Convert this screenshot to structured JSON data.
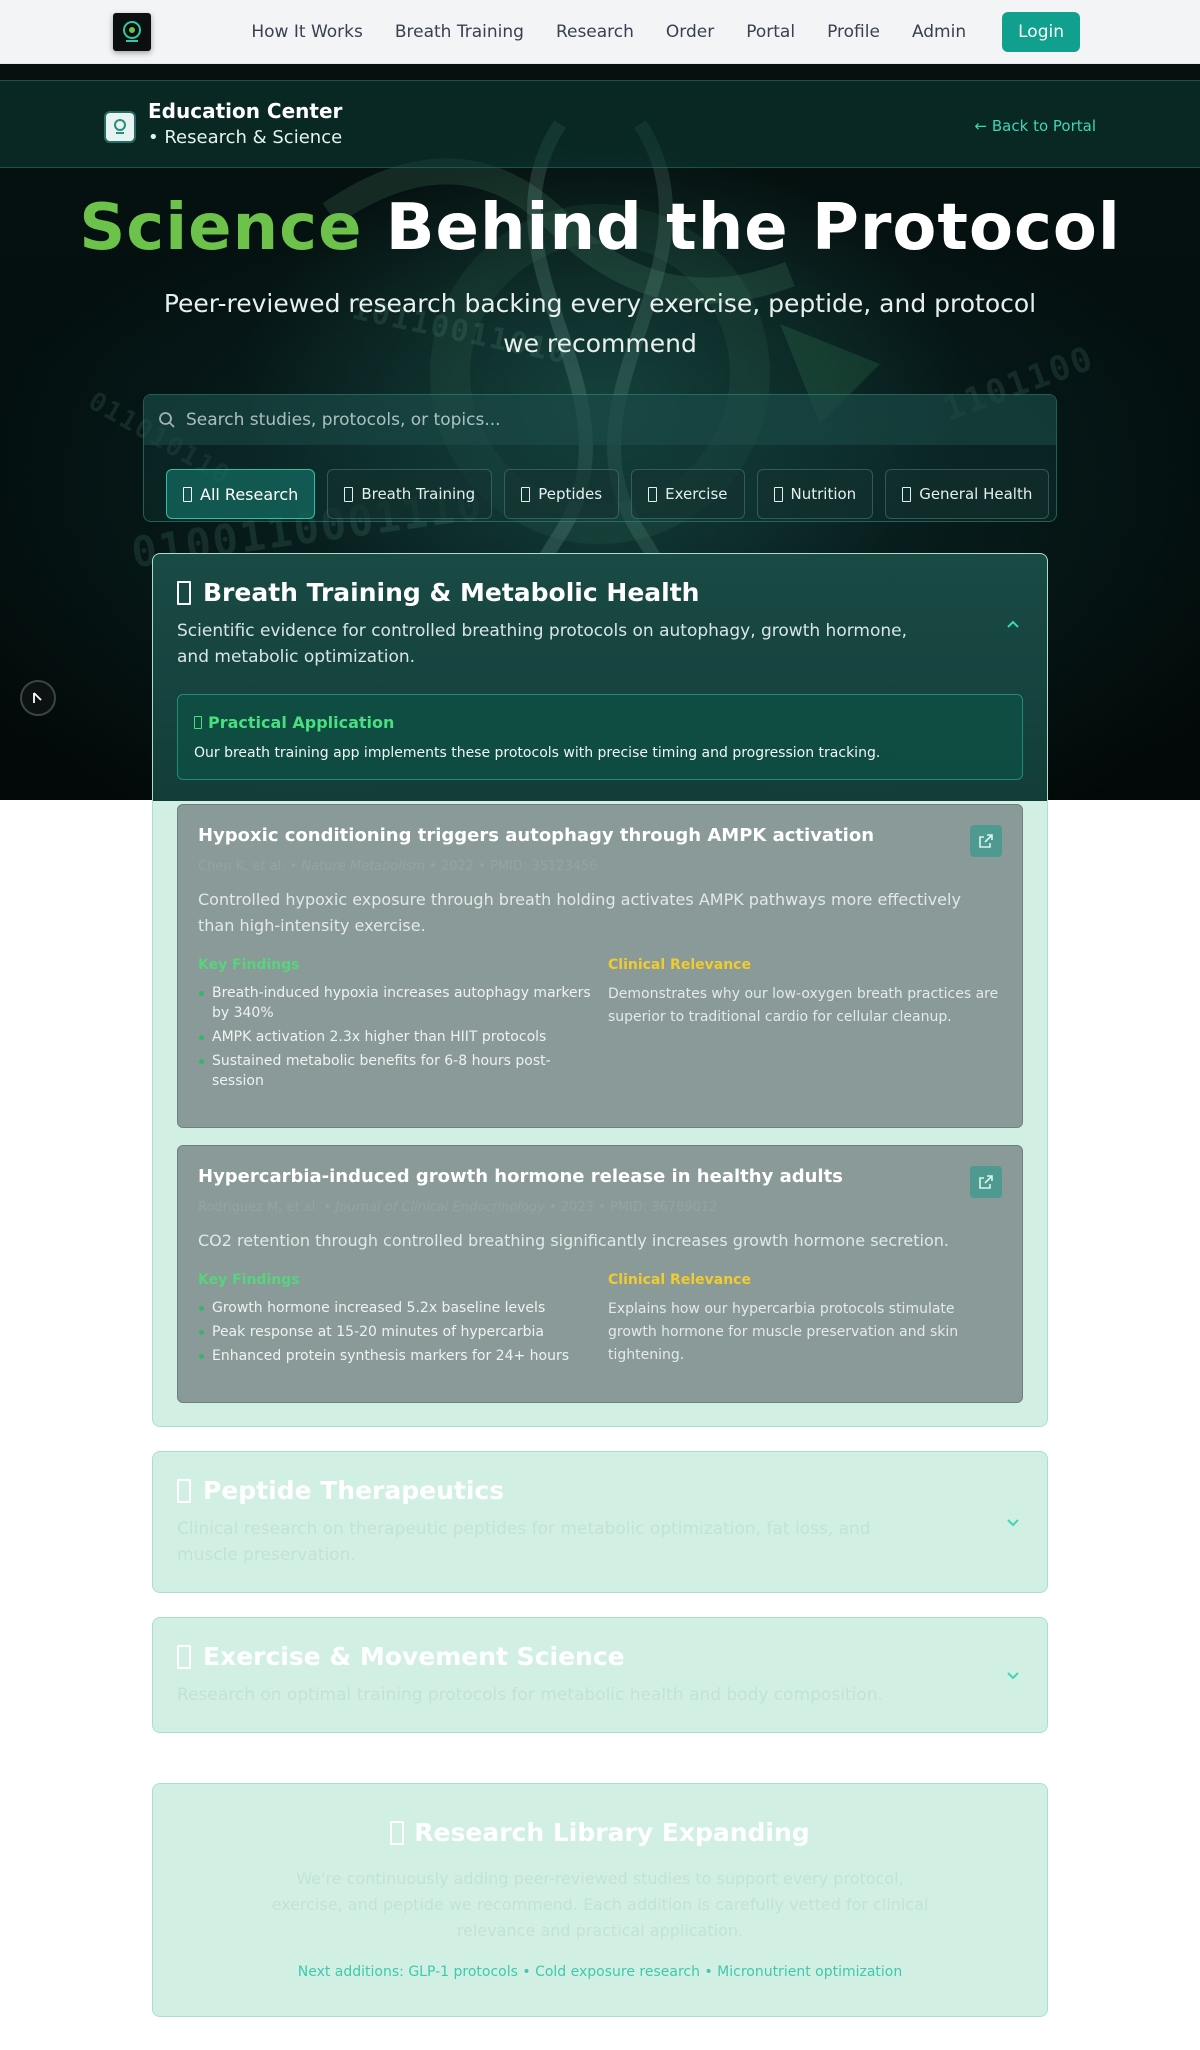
{
  "nav": {
    "logo_icon": "brain-logo-icon",
    "links": [
      "How It Works",
      "Breath Training",
      "Research",
      "Order",
      "Portal",
      "Profile",
      "Admin"
    ],
    "login_label": "Login"
  },
  "edu": {
    "title": "Education Center",
    "subtitle": "• Research & Science",
    "back_label": "← Back to Portal"
  },
  "hero": {
    "title_accent": "Science",
    "title_rest": " Behind the Protocol",
    "subtitle": "Peer-reviewed research backing every exercise, peptide, and protocol we recommend"
  },
  "search": {
    "placeholder": "Search studies, protocols, or topics..."
  },
  "filters": [
    {
      "label": "All Research",
      "active": true
    },
    {
      "label": "Breath Training",
      "active": false
    },
    {
      "label": "Peptides",
      "active": false
    },
    {
      "label": "Exercise",
      "active": false
    },
    {
      "label": "Nutrition",
      "active": false
    },
    {
      "label": "General Health",
      "active": false
    }
  ],
  "sections": {
    "breath": {
      "title": "Breath Training & Metabolic Health",
      "description": "Scientific evidence for controlled breathing protocols on autophagy, growth hormone, and metabolic optimization.",
      "practical_title": "Practical Application",
      "practical_text": "Our breath training app implements these protocols with precise timing and progression tracking."
    },
    "peptides": {
      "title": "Peptide Therapeutics",
      "description": "Clinical research on therapeutic peptides for metabolic optimization, fat loss, and muscle preservation."
    },
    "exercise": {
      "title": "Exercise & Movement Science",
      "description": "Research on optimal training protocols for metabolic health and body composition."
    }
  },
  "studies": [
    {
      "title": "Hypoxic conditioning triggers autophagy through AMPK activation",
      "authors": "Chen K, et al.",
      "journal": "Nature Metabolism",
      "meta": "• 2022 • PMID: 35123456",
      "abstract": "Controlled hypoxic exposure through breath holding activates AMPK pathways more effectively than high-intensity exercise.",
      "findings_label": "Key Findings",
      "findings": [
        "Breath-induced hypoxia increases autophagy markers by 340%",
        "AMPK activation 2.3x higher than HIIT protocols",
        "Sustained metabolic benefits for 6-8 hours post-session"
      ],
      "relevance_label": "Clinical Relevance",
      "relevance": "Demonstrates why our low-oxygen breath practices are superior to traditional cardio for cellular cleanup."
    },
    {
      "title": "Hypercarbia-induced growth hormone release in healthy adults",
      "authors": "Rodriguez M, et al.",
      "journal": "Journal of Clinical Endocrinology",
      "meta": "• 2023 • PMID: 36789012",
      "abstract": "CO2 retention through controlled breathing significantly increases growth hormone secretion.",
      "findings_label": "Key Findings",
      "findings": [
        "Growth hormone increased 5.2x baseline levels",
        "Peak response at 15-20 minutes of hypercarbia",
        "Enhanced protein synthesis markers for 24+ hours"
      ],
      "relevance_label": "Clinical Relevance",
      "relevance": "Explains how our hypercarbia protocols stimulate growth hormone for muscle preservation and skin tightening."
    }
  ],
  "library": {
    "title": "Research Library Expanding",
    "text": "We're continuously adding peer-reviewed studies to support every protocol, exercise, and peptide we recommend. Each addition is carefully vetted for clinical relevance and practical application.",
    "next": "Next additions: GLP-1 protocols • Cold exposure research • Micronutrient optimization"
  },
  "colors": {
    "accent_green": "#6cc24a",
    "teal": "#10a08d",
    "findings_green": "#58d37e",
    "relevance_yellow": "#f0cc2e"
  }
}
